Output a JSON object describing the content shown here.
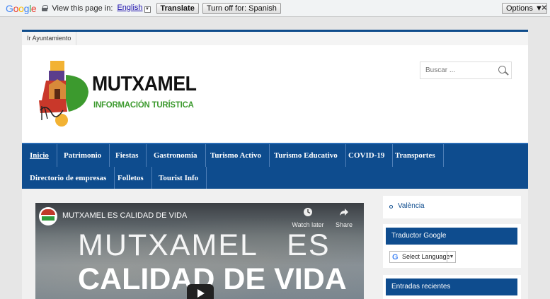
{
  "translate_bar": {
    "logo": "Google",
    "label": "View this page in:",
    "language": "English",
    "translate_label": "Translate",
    "turn_off_label": "Turn off for: Spanish",
    "options_label": "Options ▼",
    "close": "×"
  },
  "topnav": {
    "link": "Ir Ayuntamiento"
  },
  "header": {
    "site_title": "MUTXAMEL",
    "site_subtitle": "INFORMACIÓN TURÍSTICA",
    "search_placeholder": "Buscar ..."
  },
  "mainnav": {
    "row1": [
      "Inicio",
      "Patrimonio",
      "Fiestas",
      "Gastronomía",
      "Turismo Activo",
      "Turismo Educativo",
      "COVID-19",
      "Transportes"
    ],
    "row2": [
      "Directorio de empresas",
      "Folletos",
      "Tourist Info"
    ],
    "active": "Inicio"
  },
  "video": {
    "title": "MUTXAMEL ES CALIDAD DE VIDA",
    "watch_later": "Watch later",
    "share": "Share",
    "overlay_line1": "MUTXAMEL   ES",
    "overlay_line2": "CALIDAD DE VIDA"
  },
  "sidebar": {
    "link": "València",
    "translator_title": "Traductor Google",
    "select_language": "Select Language",
    "select_arrow": "▼",
    "recent_title": "Entradas recientes"
  },
  "colors": {
    "brand_blue": "#0e4c8e",
    "brand_green": "#3c9a2e"
  }
}
